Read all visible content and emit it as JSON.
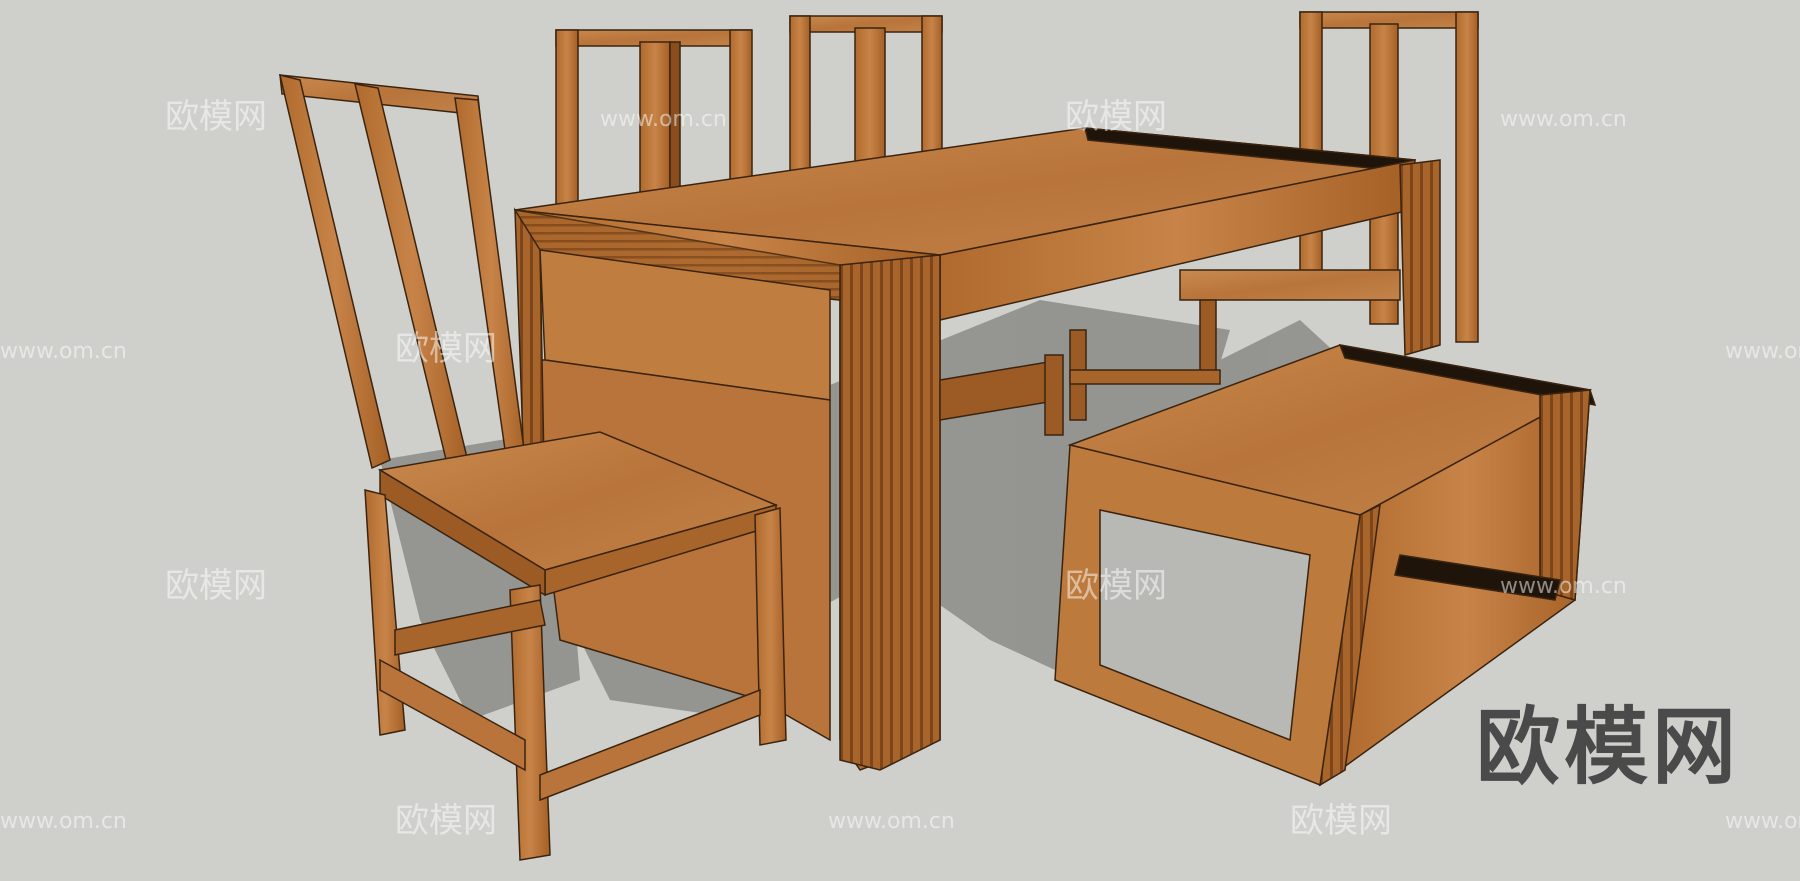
{
  "scene": {
    "background_color": "#cfd0cc",
    "wood_light": "#c9874a",
    "wood_mid": "#b26a2e",
    "wood_dark": "#7a4318",
    "shadow_color": "#8e8f8b",
    "objects": [
      "dining-table",
      "chair",
      "chair",
      "chair",
      "chair",
      "bench"
    ]
  },
  "watermarks": {
    "cn_text": "欧模网",
    "url_text": "www.om.cn"
  },
  "brand_text": "欧模网"
}
